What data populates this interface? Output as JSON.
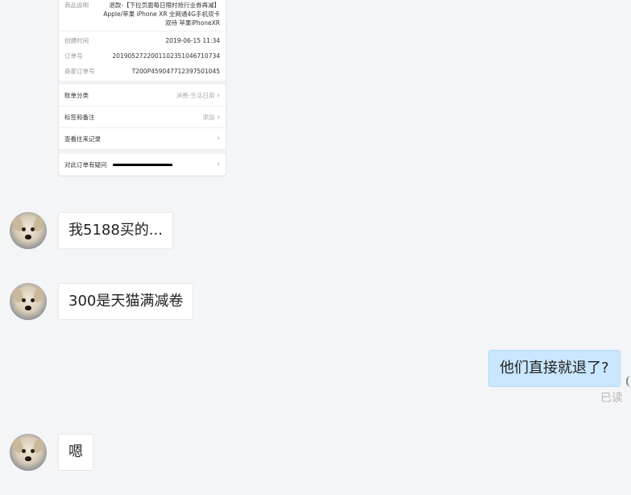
{
  "order_card": {
    "product_label": "商品说明",
    "product_value": "退款-【下拉页面每日限时抢行业券再减】Apple/苹果 iPhone XR 全网通4G手机双卡双待 苹果iPhoneXR",
    "rows": [
      {
        "label": "创建时间",
        "value": "2019-06-15 11:34"
      },
      {
        "label": "订单号",
        "value": "2019052722001102351046710734"
      },
      {
        "label": "商家订单号",
        "value": "T200P459047712397501045"
      }
    ],
    "items": [
      {
        "label": "账单分类",
        "right": "消费-生活日用"
      },
      {
        "label": "标签和备注",
        "right": "添加"
      },
      {
        "label": "查看往来记录",
        "right": ""
      },
      {
        "label": "对此订单有疑问",
        "right": ""
      }
    ]
  },
  "messages": [
    {
      "text": "我5188买的..."
    },
    {
      "text": "300是天猫满减卷"
    },
    {
      "text": "他们直接就退了?"
    },
    {
      "text": "嗯"
    }
  ],
  "read_status": "已读"
}
